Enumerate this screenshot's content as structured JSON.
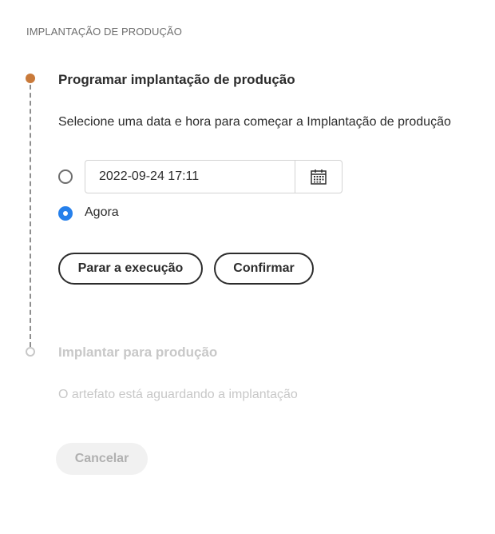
{
  "section": {
    "title": "IMPLANTAÇÃO DE PRODUÇÃO"
  },
  "step1": {
    "title": "Programar implantação de produção",
    "description": "Selecione uma data e hora para começar a Implantação de produção",
    "datetime_value": "2022-09-24 17:11",
    "radio_now_label": "Agora",
    "stop_button": "Parar a execução",
    "confirm_button": "Confirmar"
  },
  "step2": {
    "title": "Implantar para produção",
    "description": "O artefato está aguardando a implantação",
    "cancel_button": "Cancelar"
  },
  "colors": {
    "active_step": "#c97a3a",
    "radio_selected": "#2680eb",
    "disabled_text": "#c8c8c8"
  }
}
